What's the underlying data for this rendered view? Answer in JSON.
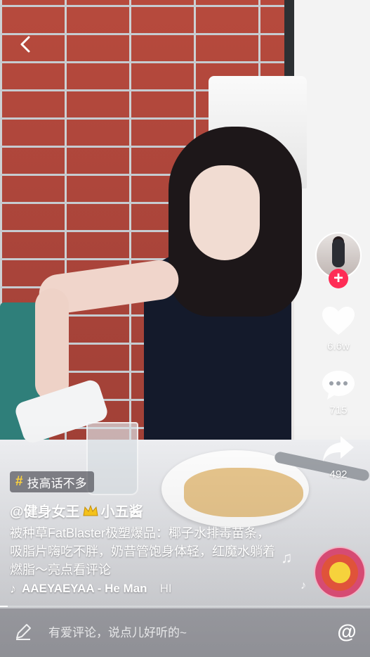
{
  "nav": {
    "back_icon": "chevron-left-icon"
  },
  "creator": {
    "avatar_icon": "creator-avatar-image",
    "follow_symbol": "+",
    "follow_color": "#fe2c55"
  },
  "actions": {
    "like_count": "6.6w",
    "comment_count": "715",
    "share_count": "492"
  },
  "hashtag": {
    "symbol": "#",
    "text": "技高话不多"
  },
  "post": {
    "author_prefix": "@健身女王",
    "author_suffix": "小五酱",
    "description": "被种草FatBlaster极塑爆品：椰子水排毒苗条，吸脂片嗨吃不胖，奶昔管饱身体轻，红魔水躺着燃脂～亮点看评论"
  },
  "music": {
    "note_symbol": "♪",
    "title": "AAEYAEYAA - He Man",
    "overflow": "HI"
  },
  "playback": {
    "progress": 0.02
  },
  "comment": {
    "placeholder": "有爱评论，说点儿好听的~",
    "at_symbol": "@"
  }
}
